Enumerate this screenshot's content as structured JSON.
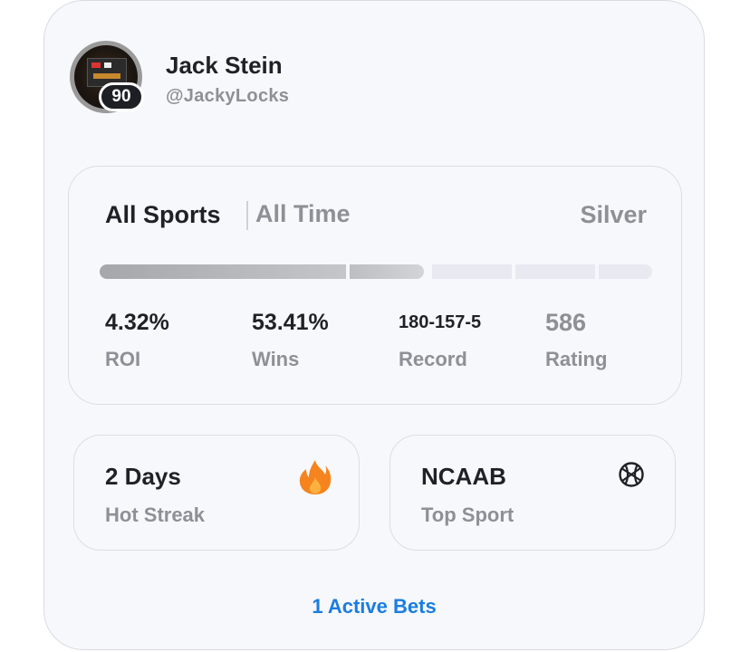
{
  "profile": {
    "name": "Jack Stein",
    "handle": "@JackyLocks",
    "level": "90"
  },
  "stats": {
    "sport_filter": "All Sports",
    "time_filter": "All Time",
    "tier": "Silver",
    "tier_progress_segments": {
      "filled": 2,
      "total": 5,
      "fraction": 0.59
    },
    "metrics": [
      {
        "value": "4.32%",
        "label": "ROI"
      },
      {
        "value": "53.41%",
        "label": "Wins"
      },
      {
        "value": "180-157-5",
        "label": "Record"
      },
      {
        "value": "586",
        "label": "Rating"
      }
    ]
  },
  "streak": {
    "title": "2 Days",
    "subtitle": "Hot Streak",
    "icon": "fire-icon",
    "icon_color": "#f5841f"
  },
  "top_sport": {
    "title": "NCAAB",
    "subtitle": "Top Sport",
    "icon": "basketball-icon"
  },
  "active_bets": {
    "label": "1 Active Bets",
    "color": "#1a7de0"
  }
}
